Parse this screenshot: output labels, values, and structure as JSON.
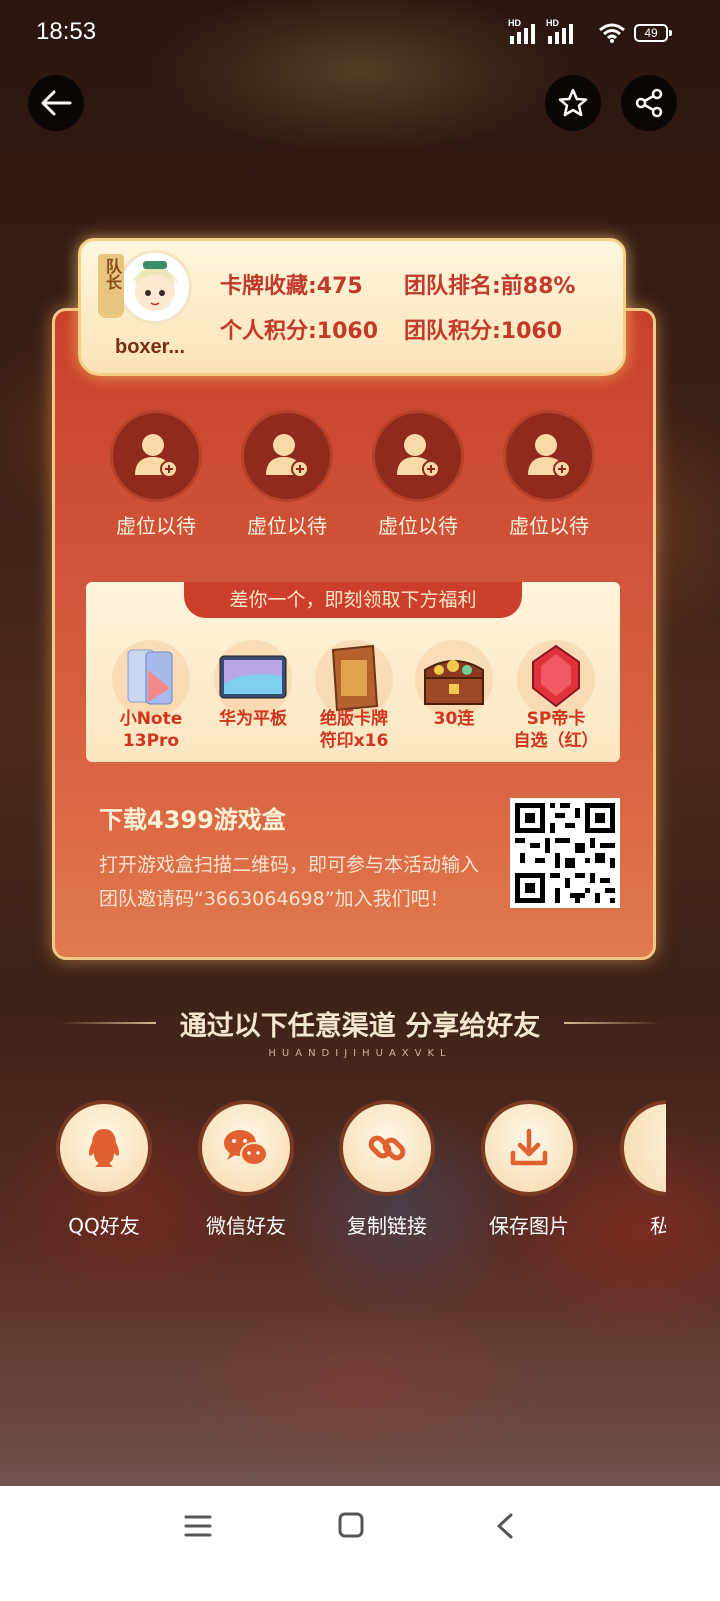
{
  "status_bar": {
    "time": "18:53",
    "battery": "49",
    "network1": "HD",
    "network2": "HD"
  },
  "team_card": {
    "leader_tag": "队长",
    "username": "boxer...",
    "card_collection": "卡牌收藏:475",
    "team_rank": "团队排名:前88%",
    "personal_points": "个人积分:1060",
    "team_points": "团队积分:1060"
  },
  "slots": [
    "虚位以待",
    "虚位以待",
    "虚位以待",
    "虚位以待"
  ],
  "rewards": {
    "banner": "差你一个，即刻领取下方福利",
    "items": [
      {
        "line1": "小Note",
        "line2": "13Pro"
      },
      {
        "line1": "华为平板",
        "line2": ""
      },
      {
        "line1": "绝版卡牌",
        "line2": "符印x16"
      },
      {
        "line1": "30连",
        "line2": ""
      },
      {
        "line1": "SP帝卡",
        "line2": "自选（红）"
      }
    ]
  },
  "download": {
    "title": "下载4399游戏盒",
    "desc": "打开游戏盒扫描二维码，即可参与本活动输入团队邀请码“3663064698”加入我们吧！"
  },
  "share": {
    "title": "通过以下任意渠道  分享给好友",
    "subtitle": "HUANDIJIHUAXVKL",
    "items": [
      {
        "label": "QQ好友",
        "icon": "qq-icon"
      },
      {
        "label": "微信好友",
        "icon": "wechat-icon"
      },
      {
        "label": "复制链接",
        "icon": "link-icon"
      },
      {
        "label": "保存图片",
        "icon": "download-icon"
      },
      {
        "label": "私",
        "icon": "message-icon"
      }
    ]
  },
  "colors": {
    "accent": "#c0392b",
    "card": "#d0543a",
    "panel": "#fff6de"
  }
}
